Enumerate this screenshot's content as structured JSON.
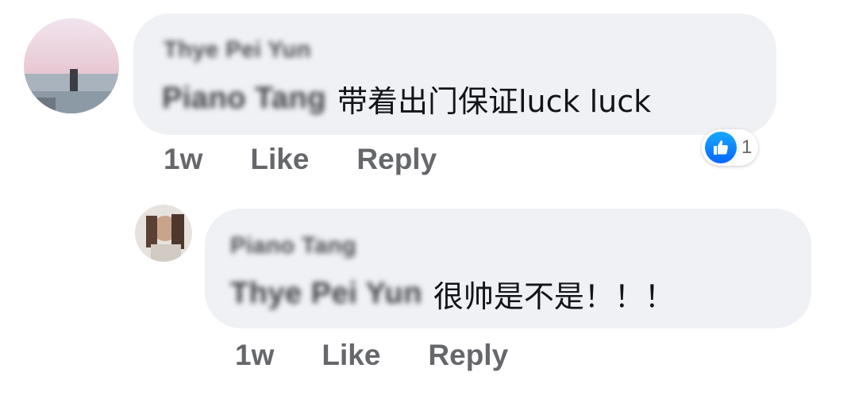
{
  "comments": [
    {
      "author": "Thye Pei Yun",
      "mention": "Piano Tang",
      "text": "带着出门保证luck luck",
      "time": "1w",
      "like_label": "Like",
      "reply_label": "Reply",
      "reaction": {
        "icon": "thumbs-up-icon",
        "count": "1",
        "color": "#0866ff"
      }
    },
    {
      "author": "Piano Tang",
      "mention": "Thye Pei Yun",
      "text": "很帅是不是！！！",
      "time": "1w",
      "like_label": "Like",
      "reply_label": "Reply"
    }
  ]
}
